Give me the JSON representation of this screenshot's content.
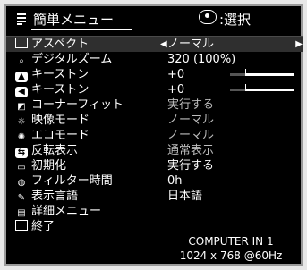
{
  "header": {
    "title": "簡単メニュー",
    "select_label": ":選択",
    "menu_icon": "menu-list-icon",
    "select_icon": "select-button-icon"
  },
  "menu": [
    {
      "icon": "aspect-icon",
      "label": "アスペクト",
      "value": "ノーマル",
      "selected": true,
      "dim": false
    },
    {
      "icon": "digital-zoom-icon",
      "label": "デジタルズーム",
      "value": "320 (100%)",
      "selected": false,
      "dim": false
    },
    {
      "icon": "keystone-v-icon",
      "label": "キーストン",
      "value": "+0",
      "selected": false,
      "dim": false,
      "slider": 0.5
    },
    {
      "icon": "keystone-h-icon",
      "label": "キーストン",
      "value": "+0",
      "selected": false,
      "dim": false,
      "slider": 0.5
    },
    {
      "icon": "corner-fit-icon",
      "label": "コーナーフィット",
      "value": "実行する",
      "selected": false,
      "dim": true
    },
    {
      "icon": "picture-mode-icon",
      "label": "映像モード",
      "value": "ノーマル",
      "selected": false,
      "dim": true
    },
    {
      "icon": "eco-mode-icon",
      "label": "エコモード",
      "value": "ノーマル",
      "selected": false,
      "dim": true
    },
    {
      "icon": "mirror-icon",
      "label": "反転表示",
      "value": "通常表示",
      "selected": false,
      "dim": false
    },
    {
      "icon": "reset-icon",
      "label": "初期化",
      "value": "実行する",
      "selected": false,
      "dim": false
    },
    {
      "icon": "filter-icon",
      "label": "フィルター時間",
      "value": "0h",
      "selected": false,
      "dim": false
    },
    {
      "icon": "language-icon",
      "label": "表示言語",
      "value": "日本語",
      "selected": false,
      "dim": false
    },
    {
      "icon": "advanced-menu-icon",
      "label": "詳細メニュー",
      "value": "",
      "selected": false,
      "dim": false
    },
    {
      "icon": "exit-icon",
      "label": "終了",
      "value": "",
      "selected": false,
      "dim": false
    }
  ],
  "source": {
    "name": "COMPUTER IN 1",
    "signal": "1024 x 768 @60Hz"
  }
}
